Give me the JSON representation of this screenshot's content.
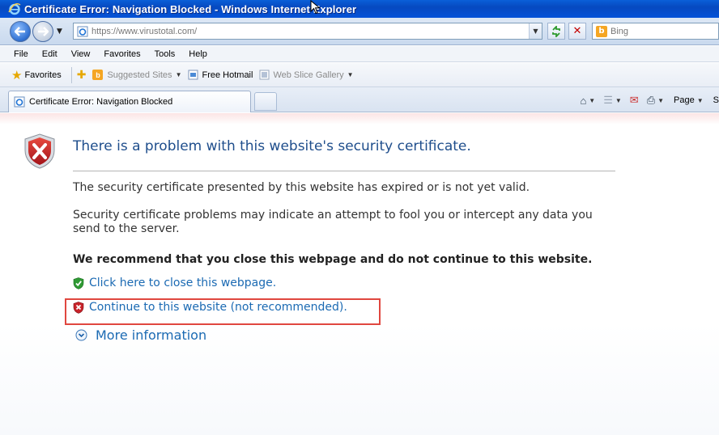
{
  "window": {
    "title": "Certificate Error: Navigation Blocked - Windows Internet Explorer"
  },
  "address_bar": {
    "url": "https://www.virustotal.com/"
  },
  "search": {
    "placeholder": "Bing"
  },
  "menu": [
    "File",
    "Edit",
    "View",
    "Favorites",
    "Tools",
    "Help"
  ],
  "favorites_bar": {
    "favorites_label": "Favorites",
    "items": [
      "Suggested Sites",
      "Free Hotmail",
      "Web Slice Gallery"
    ]
  },
  "tab": {
    "label": "Certificate Error: Navigation Blocked"
  },
  "command_bar": {
    "page_label": "Page",
    "safety_label": "S"
  },
  "error_page": {
    "title": "There is a problem with this website's security certificate.",
    "p1": "The security certificate presented by this website has expired or is not yet valid.",
    "p2": "Security certificate problems may indicate an attempt to fool you or intercept any data you send to the server.",
    "recommendation": "We recommend that you close this webpage and do not continue to this website.",
    "close_link": "Click here to close this webpage.",
    "continue_link": "Continue to this website (not recommended).",
    "more_info": "More information"
  },
  "colors": {
    "title_bar": "#0553d9",
    "link": "#1b6ab3",
    "heading": "#1f4e8c",
    "highlight": "#e0473f"
  }
}
